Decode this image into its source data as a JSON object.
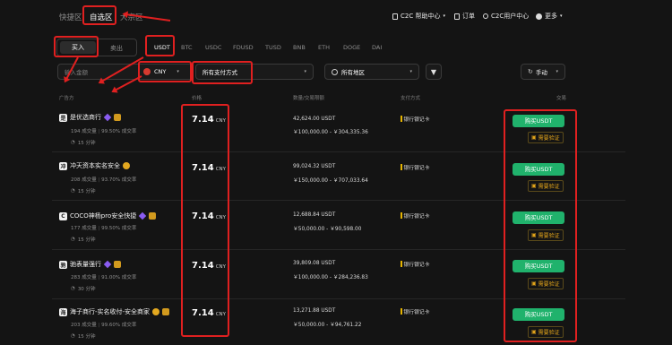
{
  "nav": {
    "tabs": [
      {
        "label": "快捷区"
      },
      {
        "label": "自选区"
      },
      {
        "label": "大宗区"
      }
    ],
    "right": [
      {
        "label": "C2C 帮助中心",
        "icon": "help-doc-icon"
      },
      {
        "label": "订单",
        "icon": "order-icon"
      },
      {
        "label": "C2C用户中心",
        "icon": "user-icon"
      },
      {
        "label": "更多",
        "icon": "more-icon"
      }
    ]
  },
  "trade_side": {
    "buy": "买入",
    "sell": "卖出"
  },
  "coins": [
    "USDT",
    "BTC",
    "USDC",
    "FDUSD",
    "TUSD",
    "BNB",
    "ETH",
    "DOGE",
    "DAI"
  ],
  "filters": {
    "amount_placeholder": "输入金额",
    "currency": "CNY",
    "payment": "所有支付方式",
    "region": "所有地区",
    "refresh": "手动"
  },
  "table": {
    "headers": {
      "advertiser": "广告方",
      "price": "价格",
      "qty": "数量/交易限额",
      "pay": "支付方式",
      "trade": "交易"
    },
    "rows": [
      {
        "name": "是优选商行",
        "logo": "是",
        "trades": "194 成交量",
        "rate": "99.50% 成交率",
        "time": "15 分钟",
        "price": "7.14",
        "unit": "CNY",
        "amount": "42,624.00 USDT",
        "limit": "￥100,000.00 - ￥304,335.36",
        "pay": "银行银记卡",
        "buy": "购买USDT",
        "verify": "需要验证"
      },
      {
        "name": "冲天资本实名安全",
        "logo": "冲",
        "trades": "208 成交量",
        "rate": "93.70% 成交率",
        "time": "15 分钟",
        "price": "7.14",
        "unit": "CNY",
        "amount": "99,024.32 USDT",
        "limit": "￥150,000.00 - ￥707,033.64",
        "pay": "银行银记卡",
        "buy": "购买USDT",
        "verify": "需要验证"
      },
      {
        "name": "COCO神杨pro安全快捷",
        "logo": "C",
        "trades": "177 成交量",
        "rate": "99.50% 成交率",
        "time": "15 分钟",
        "price": "7.14",
        "unit": "CNY",
        "amount": "12,688.84 USDT",
        "limit": "￥50,000.00 - ￥90,598.00",
        "pay": "银行银记卡",
        "buy": "购买USDT",
        "verify": "需要验证"
      },
      {
        "name": "驰表量强行",
        "logo": "驰",
        "trades": "283 成交量",
        "rate": "91.00% 成交率",
        "time": "30 分钟",
        "price": "7.14",
        "unit": "CNY",
        "amount": "39,809.08 USDT",
        "limit": "￥100,000.00 - ￥284,236.83",
        "pay": "银行银记卡",
        "buy": "购买USDT",
        "verify": "需要验证"
      },
      {
        "name": "海子商行-实名收付-安全商家",
        "logo": "海",
        "trades": "203 成交量",
        "rate": "99.60% 成交率",
        "time": "15 分钟",
        "price": "7.14",
        "unit": "CNY",
        "amount": "13,271.88 USDT",
        "limit": "￥50,000.00 - ￥94,761.22",
        "pay": "银行银记卡",
        "buy": "购买USDT",
        "verify": "需要验证"
      }
    ]
  },
  "colors": {
    "accent_green": "#20b26c",
    "annotation_red": "#e02020",
    "verify_gold": "#e0a31a"
  }
}
